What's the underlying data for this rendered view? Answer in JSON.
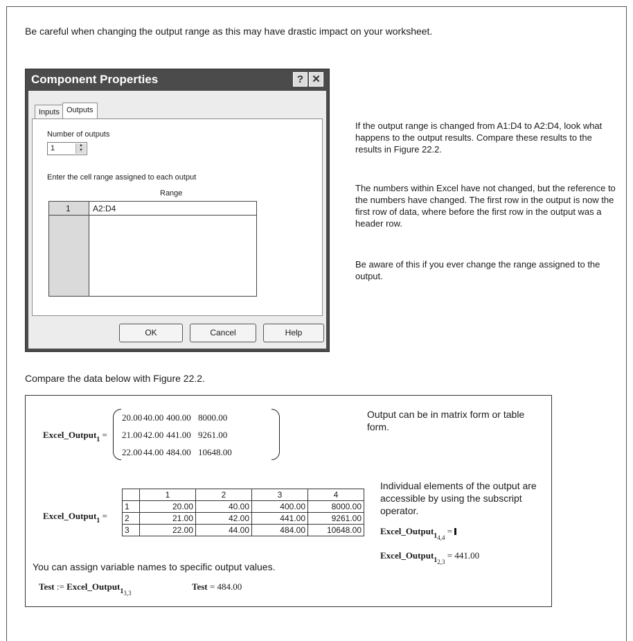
{
  "intro_text": "Be careful when changing the output range as this may have drastic impact on your worksheet.",
  "dialog": {
    "title": "Component Properties",
    "help_glyph": "?",
    "close_glyph": "✕",
    "tabs": [
      "Inputs",
      "Outputs"
    ],
    "number_of_outputs_label": "Number of outputs",
    "number_of_outputs_value": "1",
    "range_instruction": "Enter the cell range assigned to each output",
    "range_header": "Range",
    "rows": [
      {
        "index": "1",
        "range": "A2:D4"
      }
    ],
    "buttons": {
      "ok": "OK",
      "cancel": "Cancel",
      "help": "Help"
    }
  },
  "side_notes": [
    "If the output range is changed from A1:D4 to A2:D4, look what happens to the output results. Compare these results to the results in Figure 22.2.",
    "The numbers within Excel have not changed, but the reference to the numbers have changed. The first row in the output is now the first row of data, where before the first row in the output was a header row.",
    "Be aware of this if you ever change the range assigned to the output."
  ],
  "compare_text": "Compare the data below with Figure 22.2.",
  "worksheet": {
    "var_name": "Excel_Output",
    "var_subscript": "1",
    "equals": "=",
    "matrix": [
      [
        "20.00",
        "40.00",
        "400.00",
        "8000.00"
      ],
      [
        "21.00",
        "42.00",
        "441.00",
        "9261.00"
      ],
      [
        "22.00",
        "44.00",
        "484.00",
        "10648.00"
      ]
    ],
    "note_matrix": "Output can be in matrix form or table form.",
    "table_headers": [
      "1",
      "2",
      "3",
      "4"
    ],
    "table_rows": [
      {
        "idx": "1",
        "cells": [
          "20.00",
          "40.00",
          "400.00",
          "8000.00"
        ]
      },
      {
        "idx": "2",
        "cells": [
          "21.00",
          "42.00",
          "441.00",
          "9261.00"
        ]
      },
      {
        "idx": "3",
        "cells": [
          "22.00",
          "44.00",
          "484.00",
          "10648.00"
        ]
      }
    ],
    "note_subscript": "Individual elements of the output are accessible by using the subscript operator.",
    "sub_expr1_index": "4,4",
    "sub_expr2_index": "2,3",
    "sub_expr2_value": "441.00",
    "assign_text": "You can assign variable names to specific output values.",
    "test_name": "Test",
    "assign_op": ":=",
    "test_index": "3,3",
    "test_value": "484.00"
  }
}
